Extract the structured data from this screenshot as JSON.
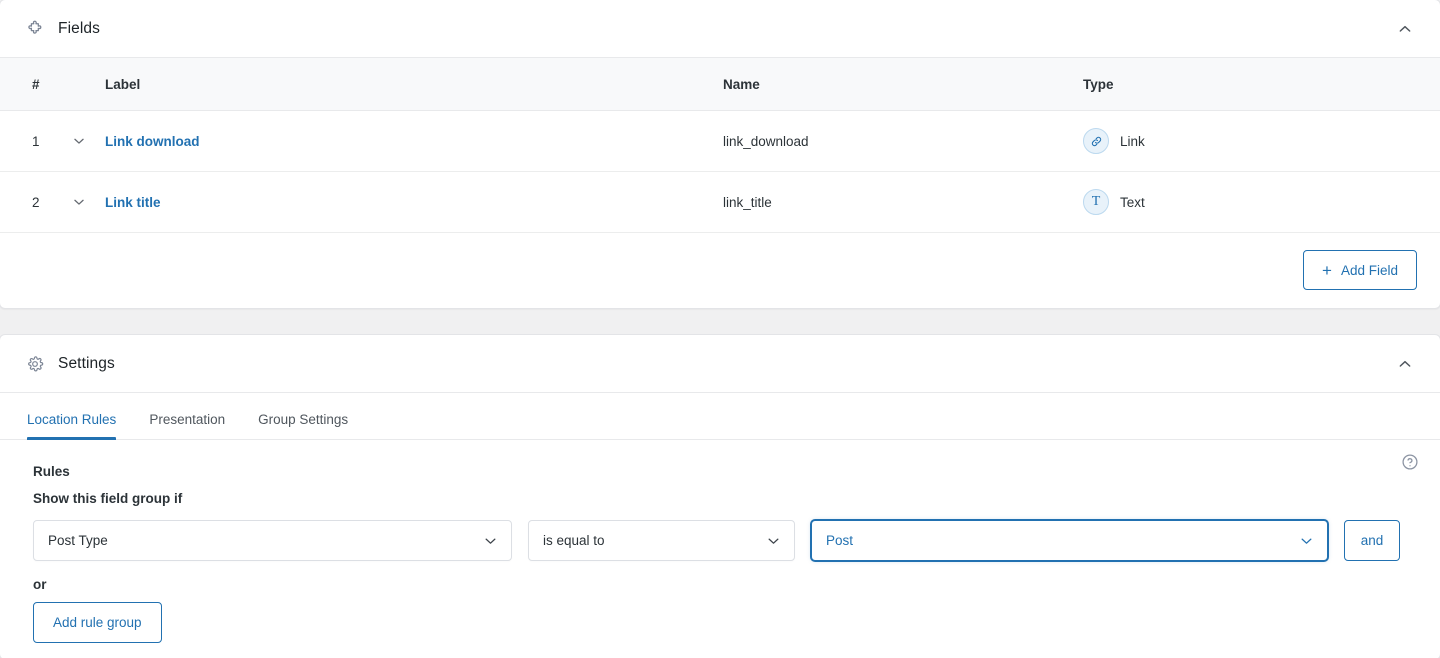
{
  "fields_panel": {
    "title": "Fields",
    "icon": "puzzle-piece-icon",
    "collapse_icon": "chevron-up-icon",
    "columns": {
      "number": "#",
      "label": "Label",
      "name": "Name",
      "type": "Type"
    },
    "rows": [
      {
        "number": "1",
        "label": "Link download",
        "name": "link_download",
        "type": "Link",
        "type_icon": "link-icon",
        "toggle_icon": "chevron-down-icon"
      },
      {
        "number": "2",
        "label": "Link title",
        "name": "link_title",
        "type": "Text",
        "type_icon": "text-t-icon",
        "toggle_icon": "chevron-down-icon"
      }
    ],
    "add_field_label": "Add Field",
    "add_field_icon": "plus-icon"
  },
  "settings_panel": {
    "title": "Settings",
    "icon": "gear-icon",
    "collapse_icon": "chevron-up-icon",
    "tabs": [
      {
        "label": "Location Rules",
        "active": true
      },
      {
        "label": "Presentation",
        "active": false
      },
      {
        "label": "Group Settings",
        "active": false
      }
    ],
    "rules": {
      "heading": "Rules",
      "help_icon": "question-circle-icon",
      "subheading": "Show this field group if",
      "param_value": "Post Type",
      "operator_value": "is equal to",
      "value_value": "Post",
      "and_label": "and",
      "or_label": "or",
      "add_rule_group_label": "Add rule group"
    }
  },
  "colors": {
    "accent": "#2271b1",
    "page_background": "#f0f0f1",
    "panel_background": "#ffffff",
    "table_header_background": "#f8f9fa",
    "text": "#2c3338",
    "muted_text": "#50575e"
  }
}
